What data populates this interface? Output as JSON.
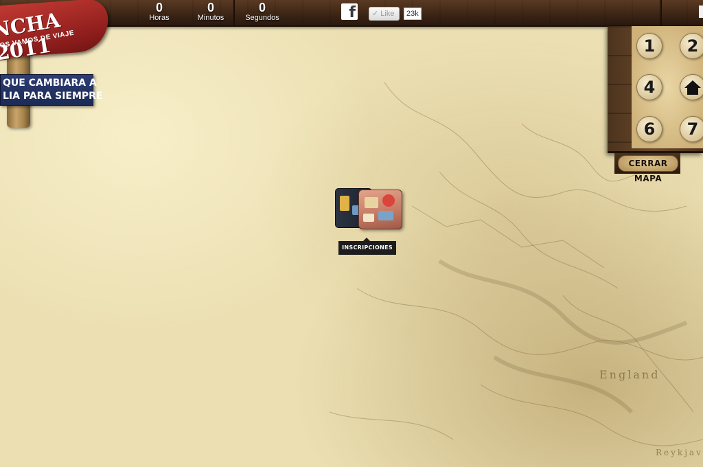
{
  "countdown": {
    "hours": {
      "value": "0",
      "label": "Horas"
    },
    "minutes": {
      "value": "0",
      "label": "Minutos"
    },
    "seconds": {
      "value": "0",
      "label": "Segundos"
    }
  },
  "social": {
    "facebook_icon": "f",
    "like_label": "Like",
    "like_count": "23k"
  },
  "logo": {
    "title": "NCHA 2011",
    "subtitle": "NOS VAMOS DE VIAJE"
  },
  "banner": {
    "line1": "QUE CAMBIARA A",
    "line2": "LIA PARA SIEMPRE"
  },
  "nav": {
    "buttons": [
      "1",
      "2",
      "4",
      "home",
      "6",
      "7"
    ],
    "close_label": "CERRAR MAPA"
  },
  "map": {
    "place_label": "England",
    "place_label_2": "Reykjavik"
  },
  "suitcase": {
    "tooltip": "INSCRIPCIONES"
  }
}
